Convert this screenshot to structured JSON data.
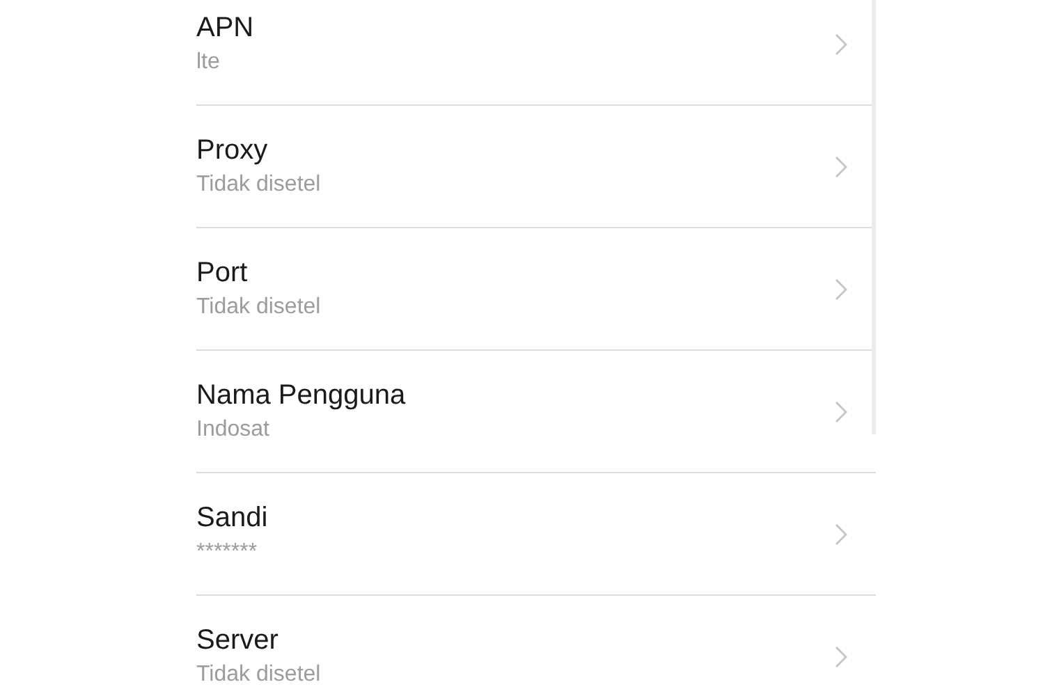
{
  "settings": [
    {
      "title": "APN",
      "value": "lte"
    },
    {
      "title": "Proxy",
      "value": "Tidak disetel"
    },
    {
      "title": "Port",
      "value": "Tidak disetel"
    },
    {
      "title": "Nama Pengguna",
      "value": "Indosat"
    },
    {
      "title": "Sandi",
      "value": "*******"
    },
    {
      "title": "Server",
      "value": "Tidak disetel"
    }
  ]
}
